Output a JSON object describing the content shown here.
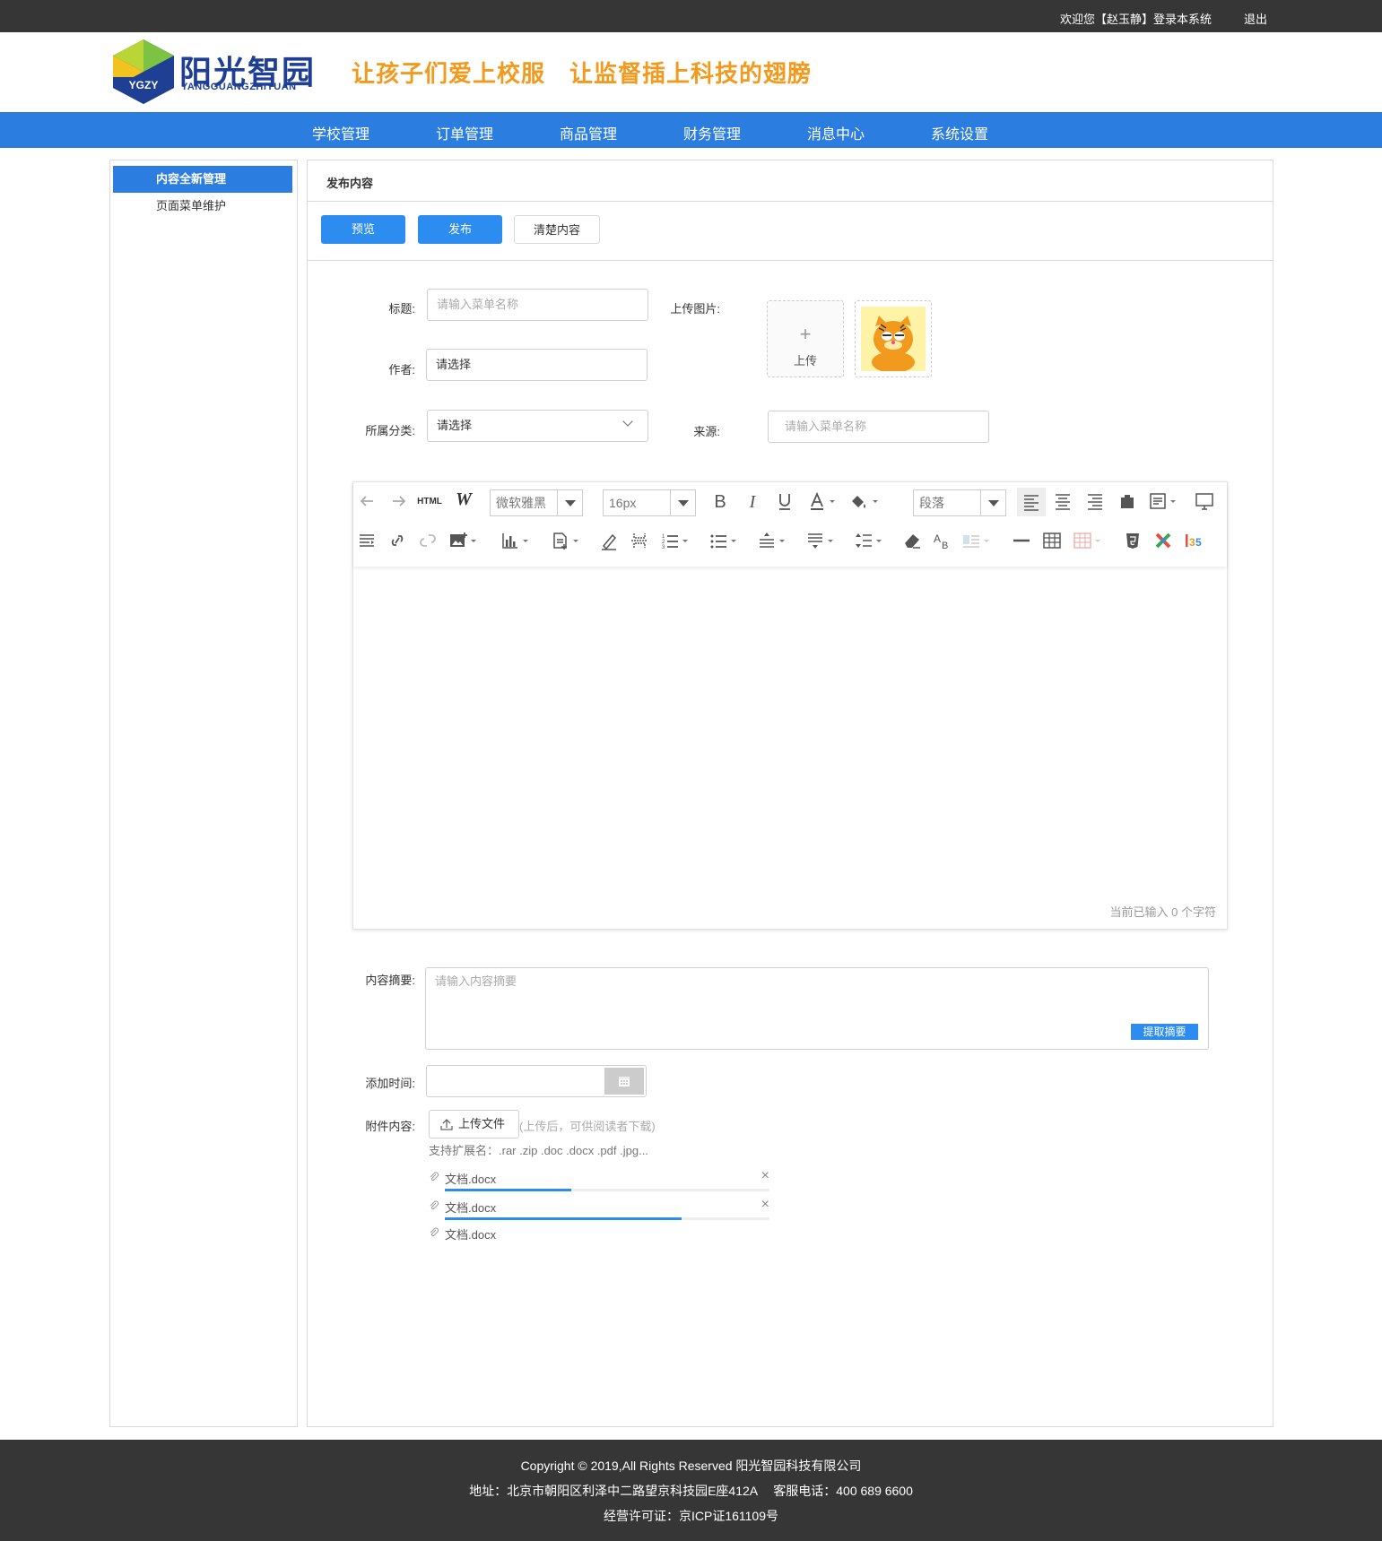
{
  "topbar": {
    "welcome": "欢迎您【赵玉静】登录本系统",
    "logout": "退出"
  },
  "brand": {
    "name_cn": "阳光智园",
    "name_en": "YANGGUANGZHIYUAN",
    "logo_badge": "YGZY",
    "slogan": "让孩子们爱上校服　让监督插上科技的翅膀",
    "brand_colors": {
      "blue": "#1f3f94",
      "green": "#7cc243",
      "orange": "#f29a1e"
    }
  },
  "nav": {
    "items": [
      "学校管理",
      "订单管理",
      "商品管理",
      "财务管理",
      "消息中心",
      "系统设置"
    ]
  },
  "sidebar": {
    "items": [
      {
        "label": "内容全新管理",
        "active": true
      },
      {
        "label": "页面菜单维护",
        "active": false
      }
    ]
  },
  "main": {
    "title": "发布内容",
    "buttons": {
      "preview": "预览",
      "publish": "发布",
      "clear": "清楚内容"
    },
    "form": {
      "title_label": "标题:",
      "title_placeholder": "请输入菜单名称",
      "author_label": "作者:",
      "author_value": "请选择",
      "category_label": "所属分类:",
      "category_value": "请选择",
      "upload_image_label": "上传图片:",
      "upload_text": "上传",
      "upload_plus": "+",
      "source_label": "来源:",
      "source_placeholder": "请输入菜单名称"
    },
    "editor": {
      "font_family": "微软雅黑",
      "font_size": "16px",
      "paragraph": "段落",
      "html_label": "HTML",
      "word_label": "W",
      "counter": "当前已输入 0 个字符"
    },
    "summary": {
      "label": "内容摘要:",
      "placeholder": "请输入内容摘要",
      "extract_button": "提取摘要"
    },
    "add_time": {
      "label": "添加时间:",
      "value": ""
    },
    "attachment": {
      "label": "附件内容:",
      "upload_button": "上传文件",
      "hint": "(上传后，可供阅读者下载)",
      "extensions": "支持扩展名：.rar .zip .doc .docx .pdf .jpg...",
      "files": [
        {
          "name": "文档.docx",
          "progress": 0.39,
          "closable": true
        },
        {
          "name": "文档.docx",
          "progress": 0.73,
          "closable": true
        },
        {
          "name": "文档.docx",
          "progress": null,
          "closable": false
        }
      ],
      "close_icon": "×"
    }
  },
  "footer": {
    "copyright": "Copyright © 2019,All Rights Reserved 阳光智园科技有限公司",
    "address": "地址：北京市朝阳区利泽中二路望京科技园E座412A　 客服电话：400 689 6600",
    "license": "经营许可证：京ICP证161109号"
  }
}
